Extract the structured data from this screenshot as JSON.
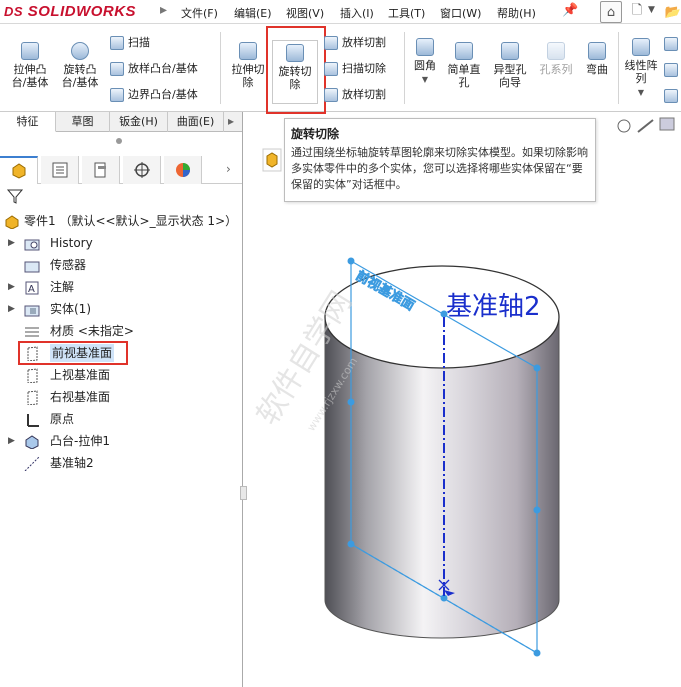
{
  "app": {
    "logo": "SOLIDWORKS",
    "logo_prefix": "DS"
  },
  "menu": [
    "文件(F)",
    "编辑(E)",
    "视图(V)",
    "插入(I)",
    "工具(T)",
    "窗口(W)",
    "帮助(H)"
  ],
  "ribbon": {
    "extrude_boss": "拉伸凸\n台/基体",
    "revolve_boss": "旋转凸\n台/基体",
    "sweep": "扫描",
    "loft_boss": "放样凸台/基体",
    "boundary_boss": "边界凸台/基体",
    "extrude_cut": "拉伸切\n除",
    "revolve_cut": "旋转切\n除",
    "loft_cut": "放样切割",
    "sweep_cut": "扫描切除",
    "loft_cut2": "放样切割",
    "fillet": "圆角",
    "simple_hole": "简单直\n孔",
    "hole_wizard": "异型孔\n向导",
    "hole_series": "孔系列",
    "bend": "弯曲",
    "linear_pattern": "线性阵\n列"
  },
  "tabs": [
    "特征",
    "草图",
    "钣金(H)",
    "曲面(E)"
  ],
  "tooltip": {
    "title": "旋转切除",
    "body": "通过围绕坐标轴旋转草图轮廓来切除实体模型。如果切除影响多实体零件中的多个实体，您可以选择将哪些实体保留在“要保留的实体”对话框中。"
  },
  "tree": {
    "root": "零件1 （默认<<默认>_显示状态 1>）",
    "items": [
      {
        "label": "History",
        "expandable": true
      },
      {
        "label": "传感器",
        "expandable": false
      },
      {
        "label": "注解",
        "expandable": true
      },
      {
        "label": "实体(1)",
        "expandable": true
      },
      {
        "label": "材质 <未指定>",
        "expandable": false
      },
      {
        "label": "前视基准面",
        "expandable": false,
        "selected": true
      },
      {
        "label": "上视基准面",
        "expandable": false
      },
      {
        "label": "右视基准面",
        "expandable": false
      },
      {
        "label": "原点",
        "expandable": false
      },
      {
        "label": "凸台-拉伸1",
        "expandable": true
      },
      {
        "label": "基准轴2",
        "expandable": false
      }
    ]
  },
  "viewport": {
    "plane_label": "前视基准面",
    "axis_label": "基准轴2",
    "watermark": "软件自学网",
    "watermark_url": "www.rjzxw.com"
  },
  "colors": {
    "accent_red": "#e0332a",
    "plane_blue": "#3c9be0",
    "axis_blue": "#1a2fcc"
  }
}
